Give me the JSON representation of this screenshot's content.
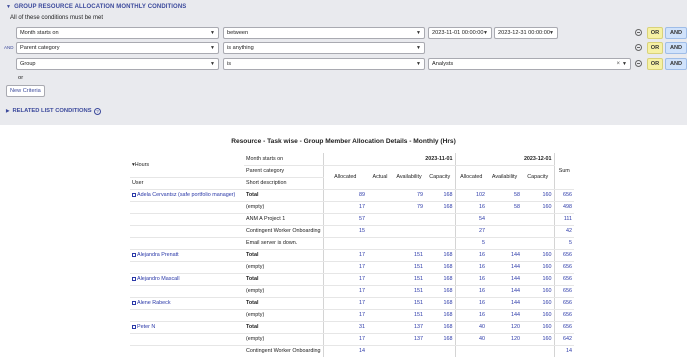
{
  "panel": {
    "title": "GROUP RESOURCE ALLOCATION MONTHLY CONDITIONS",
    "subtitle": "All of these conditions must be met",
    "and_connector": "AND",
    "or_label": "or",
    "new_criteria": "New Criteria",
    "related": "RELATED LIST CONDITIONS",
    "or_btn": "OR",
    "and_btn": "AND",
    "conditions": [
      {
        "field": "Month starts on",
        "operator": "between",
        "value1": "2023-11-01 00:00:00",
        "value2": "2023-12-31 00:00:00"
      },
      {
        "field": "Parent category",
        "operator": "is anything"
      },
      {
        "field": "Group",
        "operator": "is",
        "value": "Analysts"
      }
    ]
  },
  "report": {
    "title": "Resource - Task wise - Group Member Allocation Details - Monthly (Hrs)",
    "hours_label": "Hours",
    "month_label": "Month starts on",
    "parent_label": "Parent category",
    "user_col": "User",
    "short_desc_col": "Short description",
    "months": [
      "2023-11-01",
      "2023-12-01"
    ],
    "metrics": [
      "Allocated",
      "Actual",
      "Availability",
      "Capacity"
    ],
    "metrics_dec": [
      "Allocated",
      "Availability",
      "Capacity"
    ],
    "sum_label": "Sum",
    "rows": [
      {
        "user": "Adela Cervantsz (safe portfolio manager)",
        "desc": "Total",
        "total": true,
        "n1": [
          "89",
          "",
          "79",
          "168"
        ],
        "n2": [
          "102",
          "58",
          "160"
        ],
        "sum": "656"
      },
      {
        "user": "",
        "desc": "(empty)",
        "n1": [
          "17",
          "",
          "79",
          "168"
        ],
        "n2": [
          "16",
          "58",
          "160"
        ],
        "sum": "498"
      },
      {
        "user": "",
        "desc": "ANM A Project 1",
        "n1": [
          "57",
          "",
          "",
          ""
        ],
        "n2": [
          "54",
          "",
          ""
        ],
        "sum": "111"
      },
      {
        "user": "",
        "desc": "Contingent Worker Onboarding",
        "n1": [
          "15",
          "",
          "",
          ""
        ],
        "n2": [
          "27",
          "",
          ""
        ],
        "sum": "42"
      },
      {
        "user": "",
        "desc": "Email server is down.",
        "n1": [
          "",
          "",
          "",
          ""
        ],
        "n2": [
          "5",
          "",
          ""
        ],
        "sum": "5"
      },
      {
        "user": "Alejandra Prenatt",
        "desc": "Total",
        "total": true,
        "n1": [
          "17",
          "",
          "151",
          "168"
        ],
        "n2": [
          "16",
          "144",
          "160"
        ],
        "sum": "656"
      },
      {
        "user": "",
        "desc": "(empty)",
        "n1": [
          "17",
          "",
          "151",
          "168"
        ],
        "n2": [
          "16",
          "144",
          "160"
        ],
        "sum": "656"
      },
      {
        "user": "Alejandro Mascall",
        "desc": "Total",
        "total": true,
        "n1": [
          "17",
          "",
          "151",
          "168"
        ],
        "n2": [
          "16",
          "144",
          "160"
        ],
        "sum": "656"
      },
      {
        "user": "",
        "desc": "(empty)",
        "n1": [
          "17",
          "",
          "151",
          "168"
        ],
        "n2": [
          "16",
          "144",
          "160"
        ],
        "sum": "656"
      },
      {
        "user": "Alene Rabeck",
        "desc": "Total",
        "total": true,
        "n1": [
          "17",
          "",
          "151",
          "168"
        ],
        "n2": [
          "16",
          "144",
          "160"
        ],
        "sum": "656"
      },
      {
        "user": "",
        "desc": "(empty)",
        "n1": [
          "17",
          "",
          "151",
          "168"
        ],
        "n2": [
          "16",
          "144",
          "160"
        ],
        "sum": "656"
      },
      {
        "user": "Peter N",
        "desc": "Total",
        "total": true,
        "n1": [
          "31",
          "",
          "137",
          "168"
        ],
        "n2": [
          "40",
          "120",
          "160"
        ],
        "sum": "656"
      },
      {
        "user": "",
        "desc": "(empty)",
        "n1": [
          "17",
          "",
          "137",
          "168"
        ],
        "n2": [
          "40",
          "120",
          "160"
        ],
        "sum": "642"
      },
      {
        "user": "",
        "desc": "Contingent Worker Onboarding",
        "n1": [
          "14",
          "",
          "",
          ""
        ],
        "n2": [
          "",
          "",
          ""
        ],
        "sum": "14"
      }
    ]
  }
}
